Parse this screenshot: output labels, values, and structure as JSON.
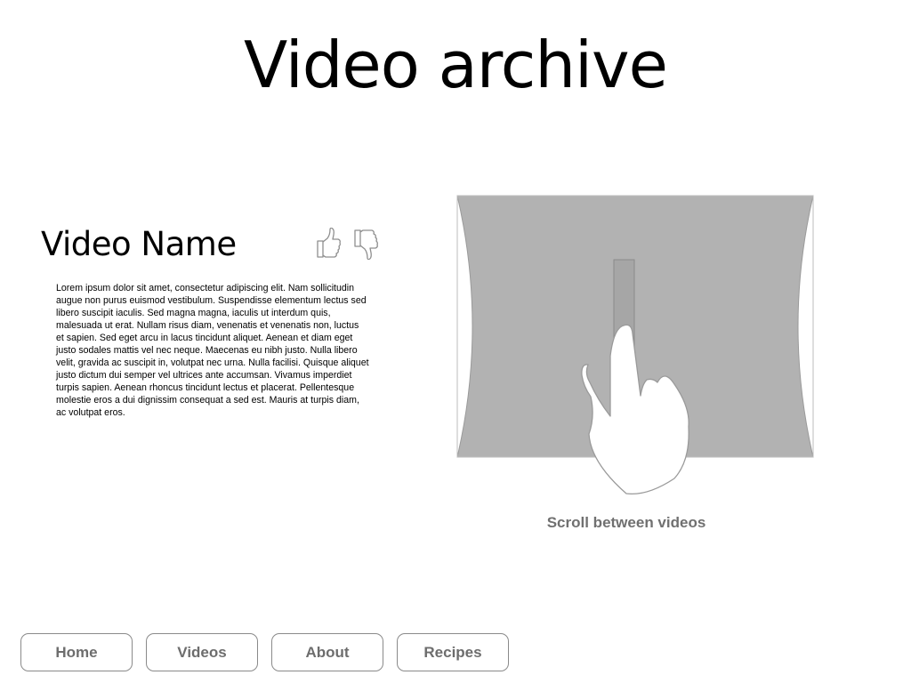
{
  "header": {
    "title": "Video archive"
  },
  "video": {
    "name": "Video Name",
    "like_icon": "thumbs-up-icon",
    "dislike_icon": "thumbs-down-icon",
    "description": "Lorem ipsum dolor sit amet, consectetur adipiscing elit. Nam sollicitudin augue non purus euismod vestibulum. Suspendisse elementum lectus sed libero suscipit iaculis. Sed magna magna, iaculis ut interdum quis, malesuada ut erat. Nullam risus diam, venenatis et venenatis non, luctus et sapien. Sed eget arcu in lacus tincidunt aliquet. Aenean et diam eget justo sodales mattis vel nec neque. Maecenas eu nibh justo. Nulla libero velit, gravida ac suscipit in, volutpat nec urna. Nulla facilisi. Quisque aliquet justo dictum dui semper vel ultrices ante accumsan. Vivamus imperdiet turpis sapien. Aenean rhoncus tincidunt lectus et placerat. Pellentesque molestie eros a dui dignissim consequat a sed est. Mauris at turpis diam, ac volutpat eros."
  },
  "scroller": {
    "gesture_icon": "swipe-hand-icon",
    "caption": "Scroll between videos",
    "panel_color": "#b2b2b2"
  },
  "nav": {
    "items": [
      {
        "label": "Home"
      },
      {
        "label": "Videos"
      },
      {
        "label": "About"
      },
      {
        "label": "Recipes"
      }
    ]
  }
}
